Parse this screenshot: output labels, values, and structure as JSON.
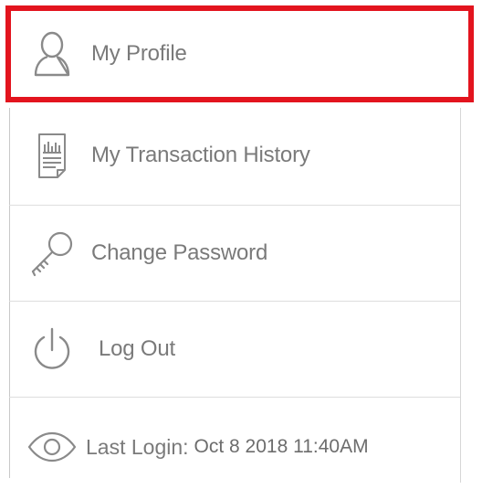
{
  "menu": {
    "items": [
      {
        "label": "My Profile",
        "icon": "user-icon",
        "selected": true
      },
      {
        "label": "My Transaction History",
        "icon": "document-chart-icon",
        "selected": false
      },
      {
        "label": "Change Password",
        "icon": "key-icon",
        "selected": false
      },
      {
        "label": "Log Out",
        "icon": "power-icon",
        "selected": false
      }
    ],
    "last_login": {
      "label": "Last Login:",
      "value": "Oct 8 2018 11:40AM",
      "icon": "eye-icon"
    }
  },
  "colors": {
    "highlight": "#e3141e",
    "text": "#7a7a7a",
    "icon": "#8a8a8a",
    "divider": "#dedede"
  }
}
